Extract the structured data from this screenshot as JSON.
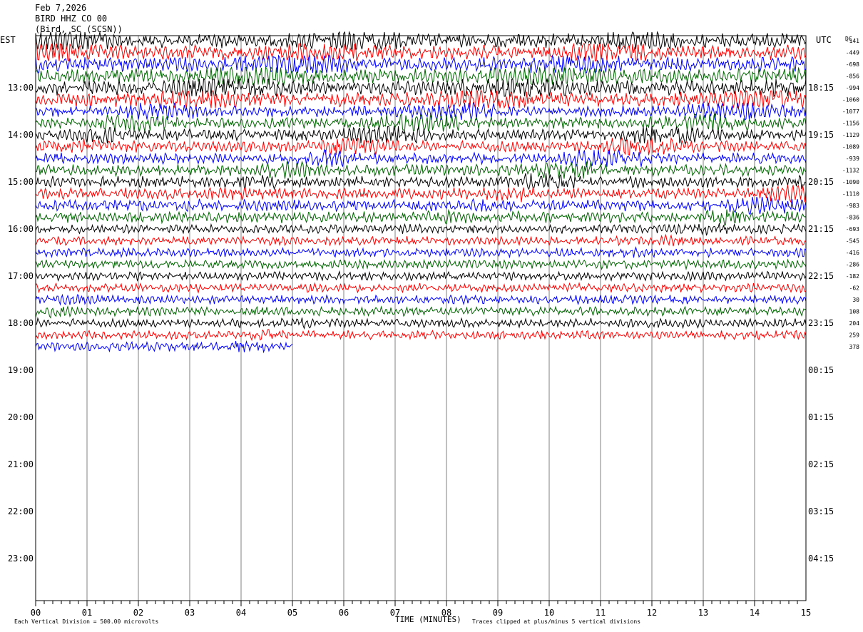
{
  "header": {
    "date": "Feb 7,2026",
    "station": "BIRD HHZ CO 00",
    "location": "(Bird, SC (SCSN))"
  },
  "labels": {
    "left_zone": "EST",
    "right_zone": "UTC",
    "dc": "DC",
    "xlabel": "TIME (MINUTES)",
    "scale_note": "Each Vertical Division =  500.00 microvolts",
    "clip_note": "Traces clipped at plus/minus 5 vertical divisions"
  },
  "colors": {
    "cycle": [
      "#000000",
      "#ff0000",
      "#0000ff",
      "#006400"
    ],
    "grid": "#808080"
  },
  "chart_data": {
    "type": "line",
    "title": "BIRD HHZ CO 00",
    "xlabel": "TIME (MINUTES)",
    "xlim": [
      0,
      15
    ],
    "x_ticks": [
      "00",
      "01",
      "02",
      "03",
      "04",
      "05",
      "06",
      "07",
      "08",
      "09",
      "10",
      "11",
      "12",
      "13",
      "14",
      "15"
    ],
    "hour_labels_est": [
      "13:00",
      "14:00",
      "15:00",
      "16:00",
      "17:00",
      "18:00",
      "19:00",
      "20:00",
      "21:00",
      "22:00",
      "23:00"
    ],
    "hour_labels_utc": [
      "18:15",
      "19:15",
      "20:15",
      "21:15",
      "22:15",
      "23:15",
      "00:15",
      "01:15",
      "02:15",
      "03:15",
      "04:15"
    ],
    "dc_offsets": [
      -141,
      -449,
      -698,
      -856,
      -994,
      -1060,
      -1077,
      -1156,
      -1129,
      -1089,
      -939,
      -1132,
      -1090,
      -1110,
      -983,
      -836,
      -693,
      -545,
      -416,
      -286,
      -182,
      -62,
      30,
      108,
      204,
      259,
      378
    ],
    "trace_count": 27,
    "last_trace_minutes": 5,
    "clip_divisions": 5,
    "microvolts_per_division": 500
  }
}
